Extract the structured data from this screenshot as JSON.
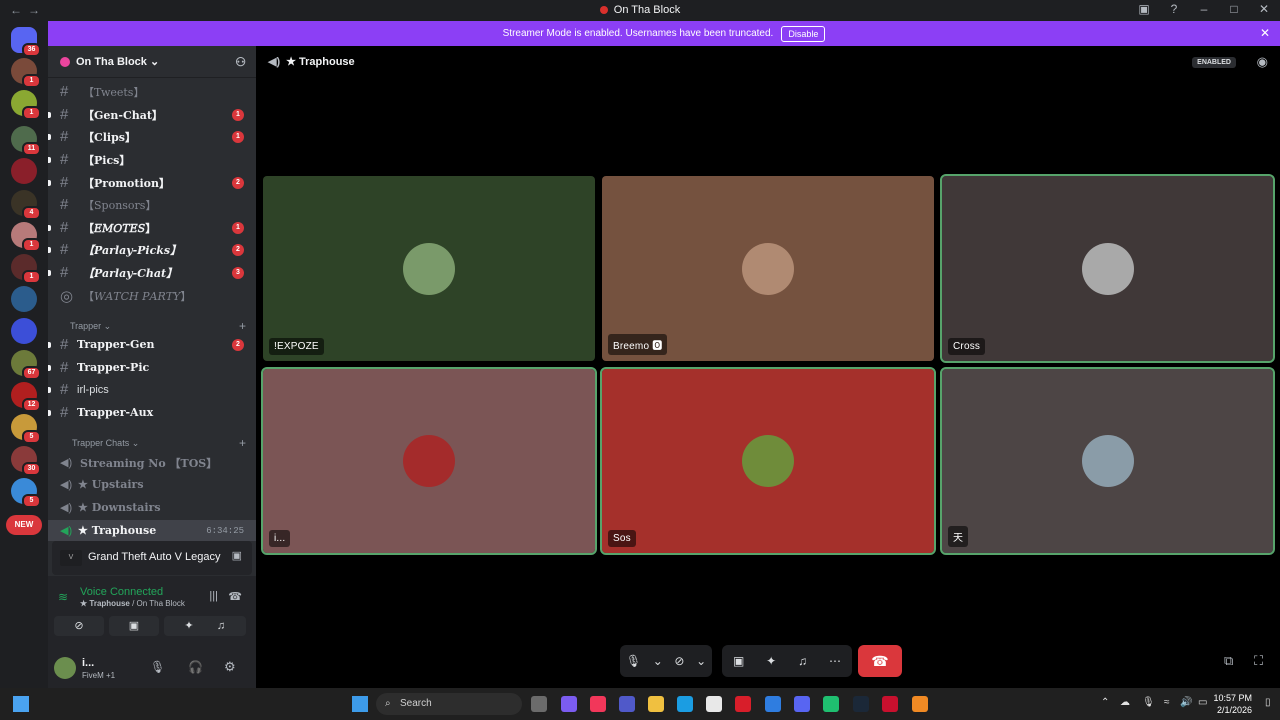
{
  "window": {
    "title": "On Tha Block",
    "nav_back": "←",
    "nav_forward": "→"
  },
  "banner": {
    "text": "Streamer Mode is enabled. Usernames have been truncated.",
    "disable_label": "Disable"
  },
  "servers": {
    "home_badge": "36",
    "badges": [
      "1",
      "1",
      "11",
      "",
      "4",
      "1",
      "1",
      "",
      "",
      "67",
      "12",
      "5",
      "30",
      "5"
    ],
    "new_label": "NEW"
  },
  "guild": {
    "name": "On Tha Block ⌄"
  },
  "channels": [
    {
      "name": "【Tweets】",
      "badge": ""
    },
    {
      "name": "【Gen-Chat】",
      "badge": "1"
    },
    {
      "name": "【Clips】",
      "badge": "1"
    },
    {
      "name": "【Pics】",
      "badge": ""
    },
    {
      "name": "【Promotion】",
      "badge": "2"
    },
    {
      "name": "【Sponsors】",
      "badge": ""
    },
    {
      "name": "【𝐸𝑀𝑂𝑇𝐸𝑆】",
      "badge": "1"
    },
    {
      "name": "【Parlay-Picks】",
      "badge": "2"
    },
    {
      "name": "【Parlay-Chat】",
      "badge": "3"
    },
    {
      "name": "【𝑊𝐴𝑇𝐶𝐻 𝑃𝐴𝑅𝑇𝑌】",
      "badge": ""
    }
  ],
  "category_trapper": "Trapper ⌄",
  "trapper_channels": [
    {
      "name": "Trapper-Gen",
      "badge": "2"
    },
    {
      "name": "Trapper-Pic",
      "badge": ""
    },
    {
      "name": "irl-pics",
      "badge": ""
    },
    {
      "name": "Trapper-Aux",
      "badge": ""
    }
  ],
  "category_chats": "Trapper Chats ⌄",
  "voice_channels": [
    {
      "name": "Streaming No 【TOS】"
    },
    {
      "name": "★ Upstairs"
    },
    {
      "name": "★ Downstairs"
    },
    {
      "name": "★ Traphouse",
      "timer": "6:34:25"
    }
  ],
  "activity": {
    "game": "Grand Theft Auto V Legacy"
  },
  "voice": {
    "status": "Voice Connected",
    "location_channel": "★ Traphouse",
    "location_guild": " / On Tha Block"
  },
  "user": {
    "name": "i...",
    "status": "FiveM +1"
  },
  "main": {
    "channel": "★ Traphouse",
    "enabled_label": "ENABLED"
  },
  "participants": [
    {
      "name": "!EXPOZE",
      "bg": "#2e4327",
      "av": "#7a9a6a"
    },
    {
      "name": "Breemo 🅾",
      "bg": "#75523f",
      "av": "#b08a72"
    },
    {
      "name": "Cross",
      "bg": "#403838",
      "av": "#a9a9a9"
    },
    {
      "name": "i...",
      "bg": "#7b5555",
      "av": "#a42b2b"
    },
    {
      "name": "Sos",
      "bg": "#a5302b",
      "av": "#6f8c3a"
    },
    {
      "name": "天",
      "bg": "#4d4545",
      "av": "#8a9ca8"
    }
  ],
  "taskbar": {
    "search_placeholder": "Search",
    "time": "10:57 PM",
    "date": "2/1/2026"
  }
}
